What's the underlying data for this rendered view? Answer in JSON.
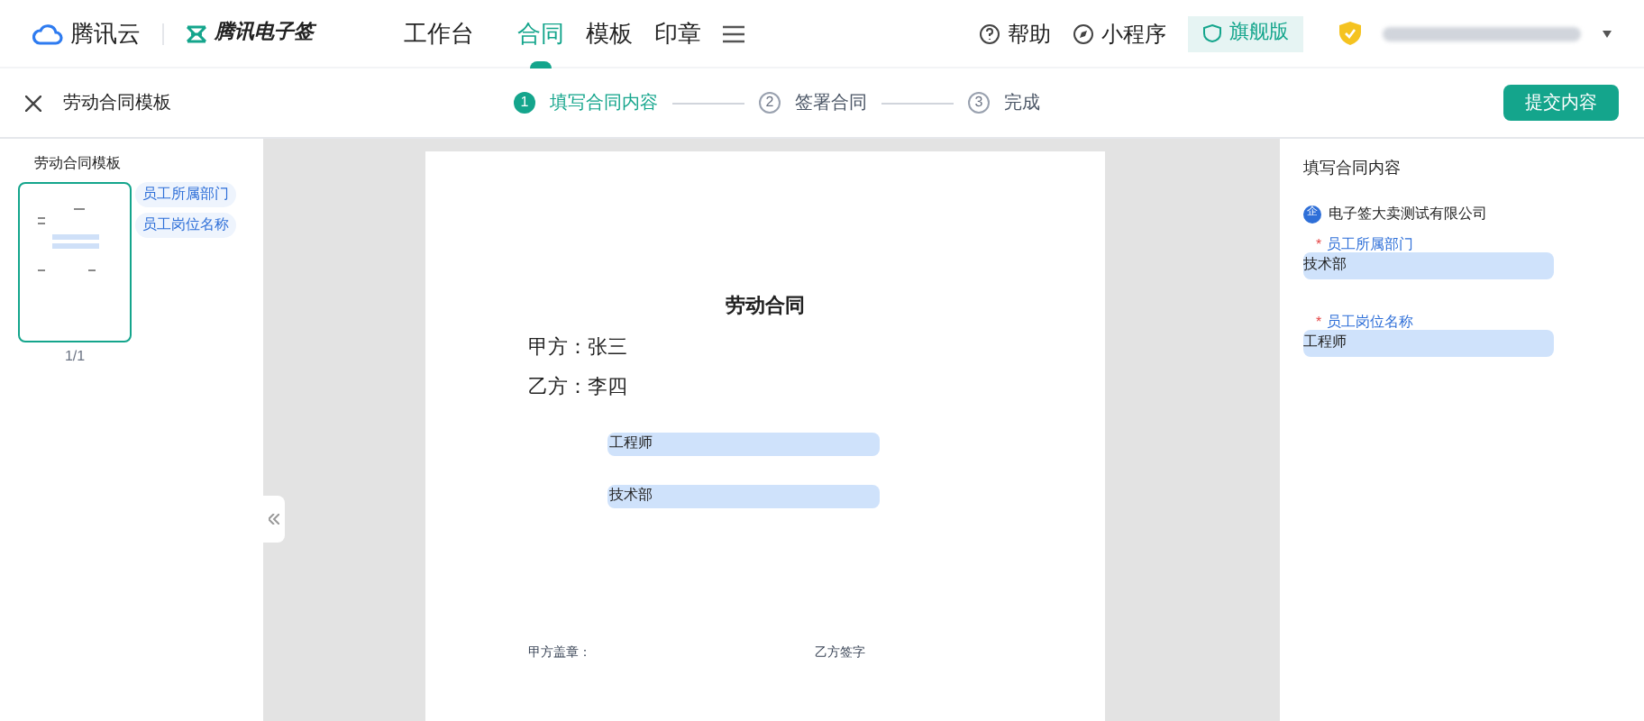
{
  "brand": {
    "cloud": "腾讯云",
    "product": "腾讯电子签"
  },
  "nav": [
    {
      "label": "工作台",
      "selected": false
    },
    {
      "label": "合同",
      "selected": true
    },
    {
      "label": "模板",
      "selected": false
    },
    {
      "label": "印章",
      "selected": false
    }
  ],
  "header_links": [
    {
      "label": "帮助",
      "kind": "help"
    },
    {
      "label": "小程序",
      "kind": "mini"
    }
  ],
  "edition": "旗舰版",
  "toolbar": {
    "title": "劳动合同模板",
    "submit": "提交内容"
  },
  "steps": [
    {
      "number": "1",
      "label": "填写合同内容",
      "selected": true
    },
    {
      "number": "2",
      "label": "签署合同",
      "selected": false
    },
    {
      "number": "3",
      "label": "完成",
      "selected": false
    }
  ],
  "left": {
    "title": "劳动合同模板",
    "page": "1/1",
    "fields": [
      "员工所属部门",
      "员工岗位名称"
    ]
  },
  "document": {
    "title": "劳动合同",
    "parties": [
      {
        "label": "甲方：",
        "value": "张三"
      },
      {
        "label": "乙方：",
        "value": "李四"
      }
    ],
    "fields": [
      "工程师",
      "技术部"
    ],
    "signatures": [
      "甲方盖章：",
      "乙方签字"
    ]
  },
  "right": {
    "title": "填写合同内容",
    "company": "电子签大卖测试有限公司",
    "company_badge": "企",
    "fields": [
      {
        "label": "员工所属部门",
        "value": "技术部",
        "required_mark": "*"
      },
      {
        "label": "员工岗位名称",
        "value": "工程师",
        "required_mark": "*"
      }
    ]
  }
}
